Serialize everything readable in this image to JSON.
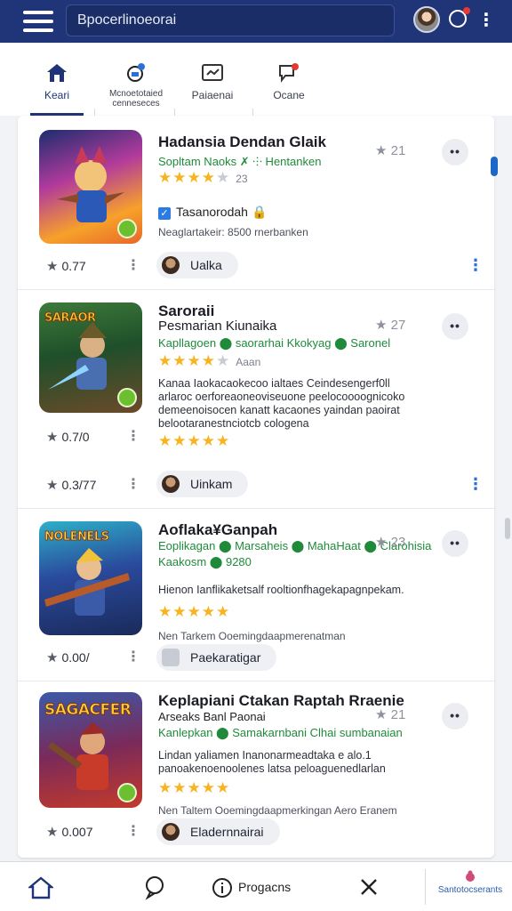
{
  "search": {
    "value": "Bpocerlinoeorai"
  },
  "tabs": [
    {
      "label": "Keari",
      "icon": "home-icon"
    },
    {
      "label": "Mcnoetotaied\ncenneseces",
      "icon": "badge-add-icon"
    },
    {
      "label": "Paiaenai",
      "icon": "window-icon"
    },
    {
      "label": "Ocane",
      "icon": "chat-alert-icon"
    }
  ],
  "items": [
    {
      "title": "Hadansia Dendan Glaik",
      "subtitle": "Sopltam Naoks ✗ ⸭ Hentanken",
      "stars": 3,
      "rating_count": "23",
      "check_label": "Tasanorodah",
      "meta": "Neaglartakeir: 8500 rnerbanken",
      "rank": "21",
      "score": "0.77",
      "chip_label": "Ualka",
      "thumb_word": ""
    },
    {
      "title": "Saroraii",
      "title2": "Pesmarian Kiunaika",
      "subtitle": "Kapllagoen ⬤ saorarhai Kkokyag ⬤ Saronel",
      "stars": 4,
      "rating_count": "Aaan",
      "description": "Kanaa Iaokacaokecoo ialtaes Ceindesengerf0ll arlaroc oerforeaoneoviseuone peelocoooognicoko demeenoisocen kanatt kacaones yaindan paoirat belootaranestnciotcb cologena",
      "rank": "27",
      "score": "0.7/0",
      "score2": "0.3/77",
      "chip_label": "Uinkam",
      "thumb_word": "SARAOR"
    },
    {
      "title": "Aoflaka¥Ganpah",
      "subtitle": "Eoplikagan ⬤ Marsaheis ⬤ MahaHaat ⬤ Clarohisia",
      "subtitle2": "Kaakosm ⬤ 9280",
      "description": "Hienon Ianflikaketsalf rooltionfhagekapagnpekam.",
      "stars": 4,
      "rating_count": "",
      "meta": "Nen Tarkem Ooemingdaapmerenatman",
      "rank": "23",
      "score": "0.00/",
      "chip_label": "Paekaratigar",
      "thumb_word": "NOLENELS"
    },
    {
      "title": "Keplapiani Ctakan Raptah Rraenie",
      "subtitle_dark": "Arseaks Banl Paonai",
      "subtitle": "Kanlepkan ⬤ Samakarnbani Clhai sumbanaian",
      "description": "Lindan yaliamen Inanonarmeadtaka e alo.1 panoakenoenoolenes latsa peloaguenedlarlan",
      "stars": 4,
      "rating_count": "",
      "meta": "Nen Taltem Ooemingdaapmerkingan Aero Eranem",
      "rank": "21",
      "score": "0.007",
      "chip_label": "Eladernnairai",
      "thumb_word": "SAGACFER"
    }
  ],
  "bottom_nav": {
    "programs_label": "Progacns",
    "last_label": "Santotocserants"
  },
  "colors": {
    "header": "#1f3577",
    "accent": "#2c6fd6",
    "star": "#f6b51e",
    "green": "#1f8a3a"
  }
}
